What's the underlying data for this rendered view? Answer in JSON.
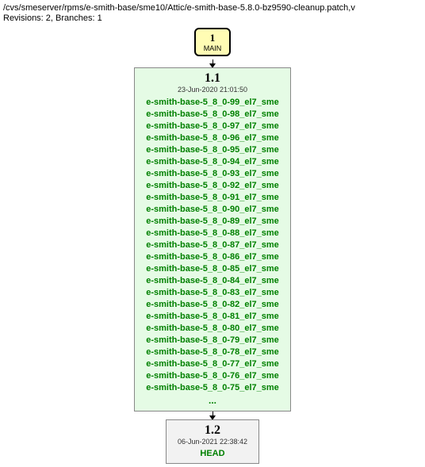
{
  "header": {
    "path": "/cvs/smeserver/rpms/e-smith-base/sme10/Attic/e-smith-base-5.8.0-bz9590-cleanup.patch,v",
    "revisions_line": "Revisions: 2, Branches: 1"
  },
  "branch": {
    "num": "1",
    "name": "MAIN"
  },
  "rev1": {
    "num": "1.1",
    "date": "23-Jun-2020 21:01:50",
    "tags": [
      "e-smith-base-5_8_0-99_el7_sme",
      "e-smith-base-5_8_0-98_el7_sme",
      "e-smith-base-5_8_0-97_el7_sme",
      "e-smith-base-5_8_0-96_el7_sme",
      "e-smith-base-5_8_0-95_el7_sme",
      "e-smith-base-5_8_0-94_el7_sme",
      "e-smith-base-5_8_0-93_el7_sme",
      "e-smith-base-5_8_0-92_el7_sme",
      "e-smith-base-5_8_0-91_el7_sme",
      "e-smith-base-5_8_0-90_el7_sme",
      "e-smith-base-5_8_0-89_el7_sme",
      "e-smith-base-5_8_0-88_el7_sme",
      "e-smith-base-5_8_0-87_el7_sme",
      "e-smith-base-5_8_0-86_el7_sme",
      "e-smith-base-5_8_0-85_el7_sme",
      "e-smith-base-5_8_0-84_el7_sme",
      "e-smith-base-5_8_0-83_el7_sme",
      "e-smith-base-5_8_0-82_el7_sme",
      "e-smith-base-5_8_0-81_el7_sme",
      "e-smith-base-5_8_0-80_el7_sme",
      "e-smith-base-5_8_0-79_el7_sme",
      "e-smith-base-5_8_0-78_el7_sme",
      "e-smith-base-5_8_0-77_el7_sme",
      "e-smith-base-5_8_0-76_el7_sme",
      "e-smith-base-5_8_0-75_el7_sme"
    ],
    "ellipsis": "..."
  },
  "rev2": {
    "num": "1.2",
    "date": "06-Jun-2021 22:38:42",
    "head": "HEAD"
  }
}
